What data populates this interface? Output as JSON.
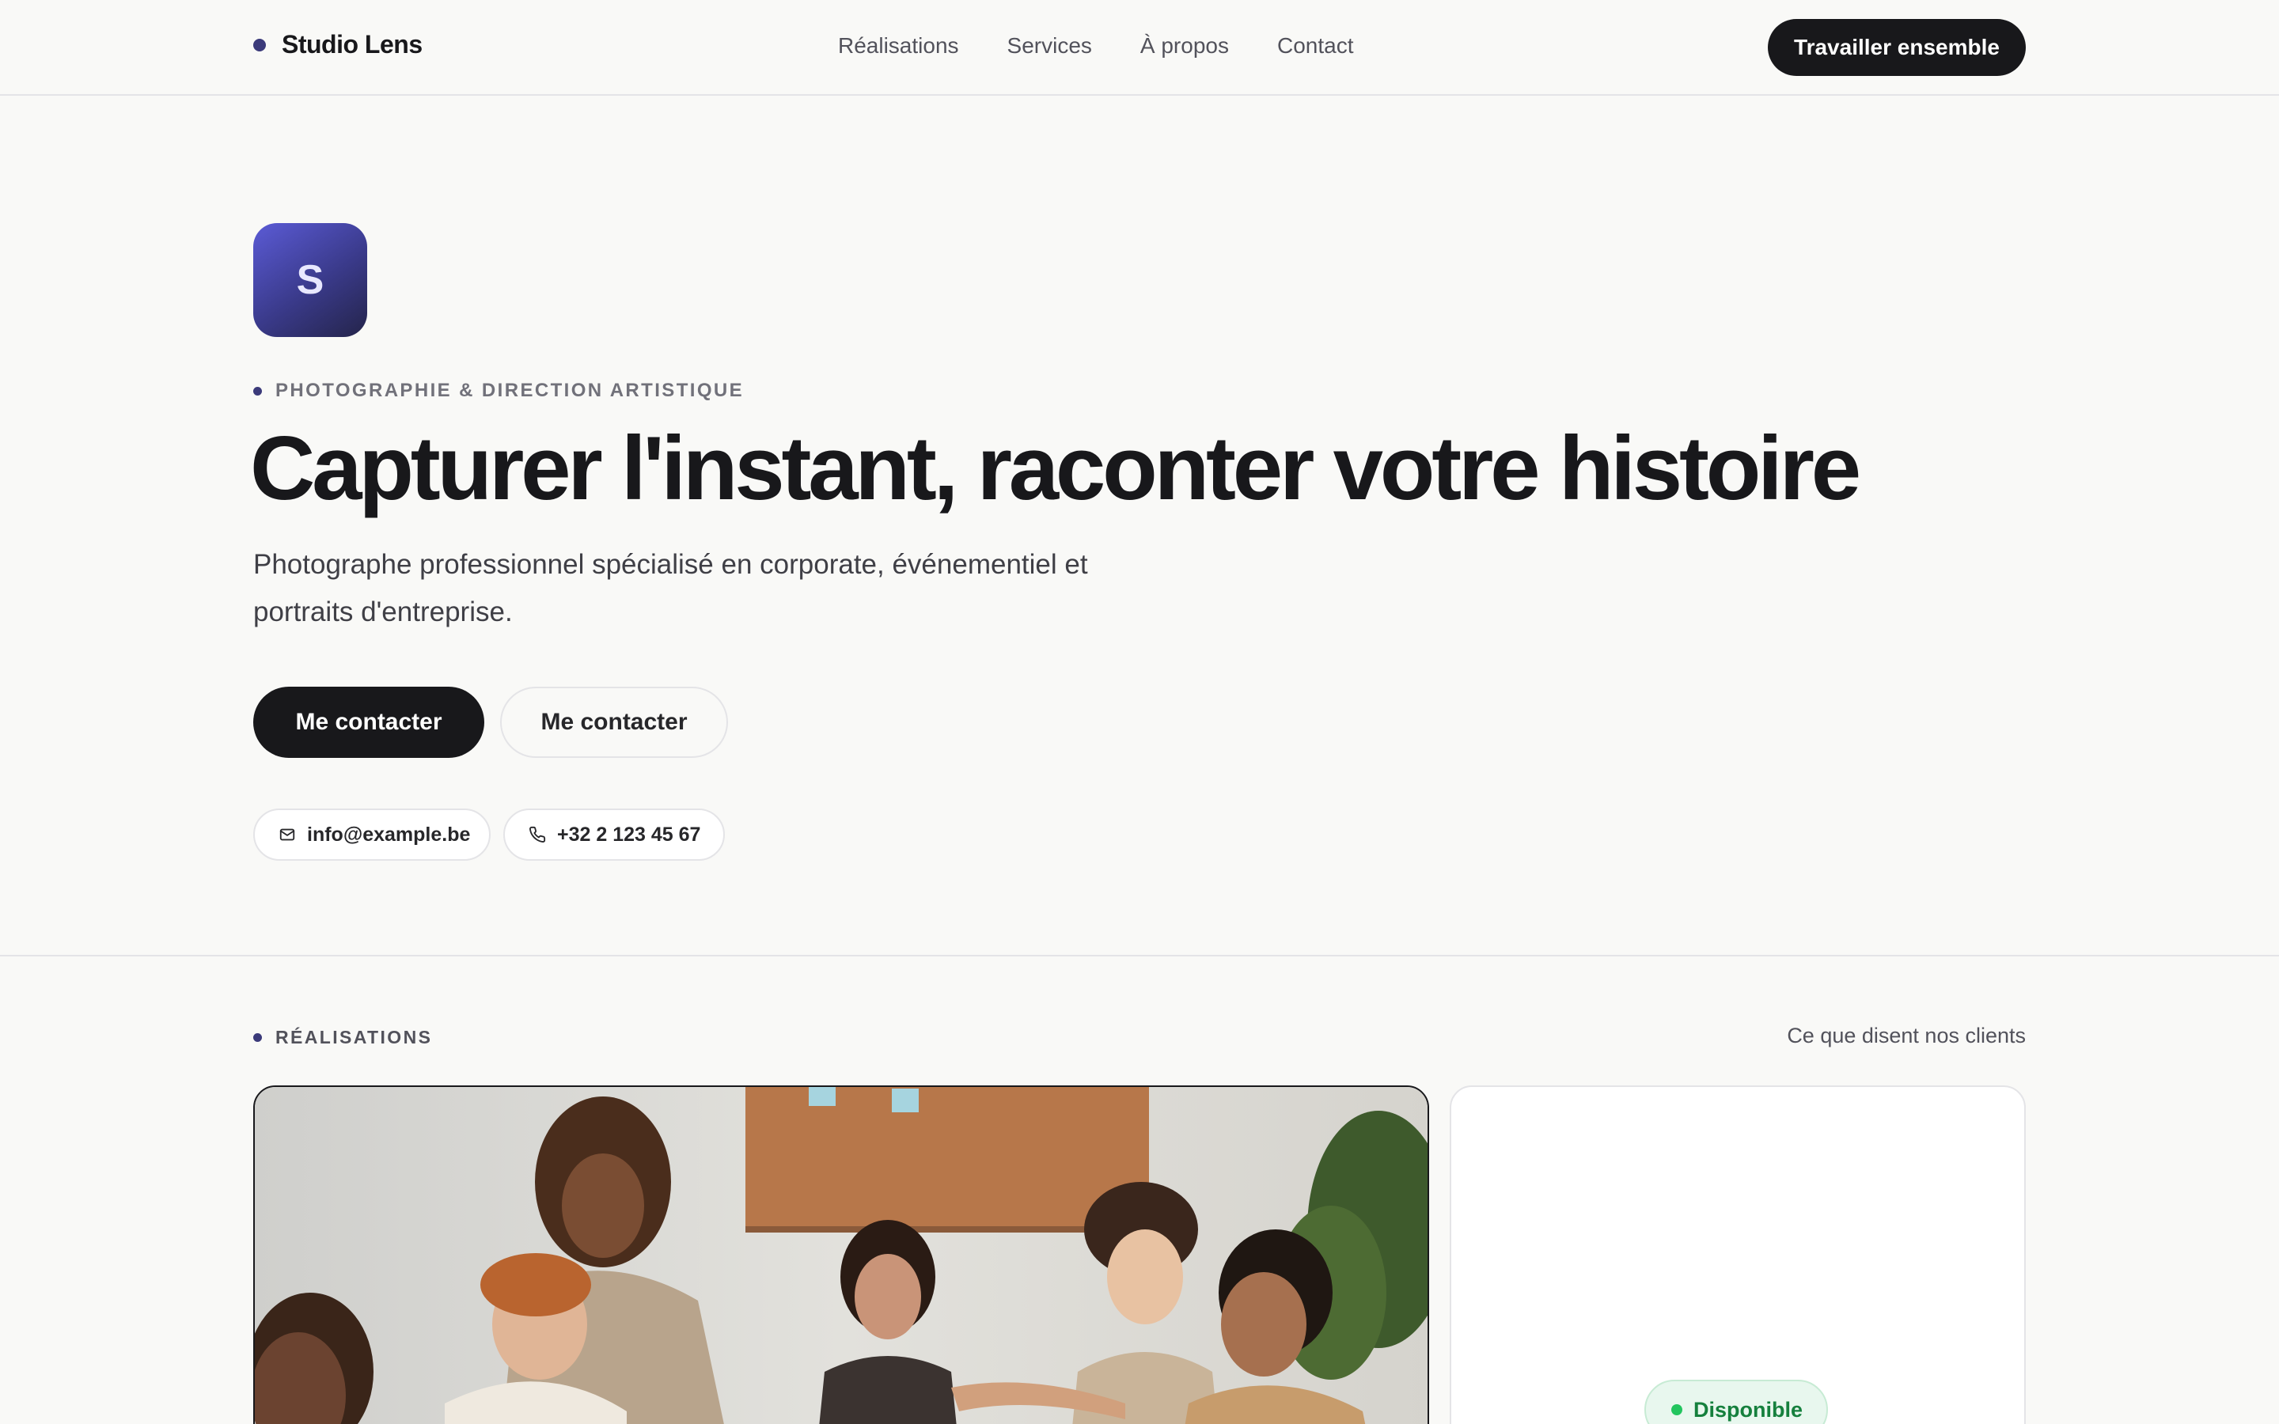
{
  "header": {
    "brand": "Studio Lens",
    "nav": [
      "Réalisations",
      "Services",
      "À propos",
      "Contact"
    ],
    "cta": "Travailler ensemble"
  },
  "hero": {
    "logo_letter": "S",
    "eyebrow": "PHOTOGRAPHIE & DIRECTION ARTISTIQUE",
    "headline": "Capturer l'instant, raconter votre histoire",
    "subtitle": "Photographe professionnel spécialisé en corporate, événementiel et portraits d'entreprise.",
    "primary_button": "Me contacter",
    "secondary_button": "Me contacter",
    "email": "info@example.be",
    "phone": "+32 2 123 45 67"
  },
  "realisations": {
    "eyebrow": "RÉALISATIONS",
    "link": "Ce que disent nos clients",
    "status": "Disponible"
  },
  "colors": {
    "accent": "#3b3a7a",
    "dark": "#18181b",
    "available": "#22c55e"
  },
  "icons": [
    "mail-icon",
    "phone-icon"
  ]
}
